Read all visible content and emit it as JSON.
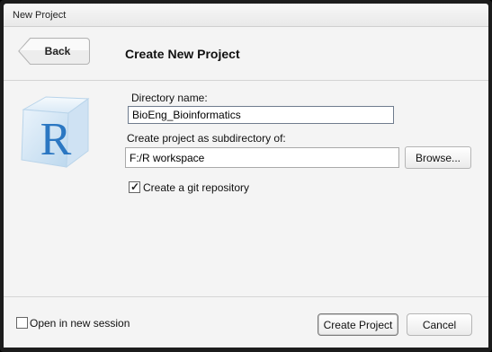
{
  "window": {
    "title": "New Project"
  },
  "header": {
    "back_label": "Back",
    "page_title": "Create New Project"
  },
  "form": {
    "directory_label": "Directory name:",
    "directory_value": "BioEng_Bioinformatics",
    "subdir_label": "Create project as subdirectory of:",
    "subdir_value": "F:/R workspace",
    "browse_label": "Browse...",
    "git_label": "Create a git repository",
    "git_checked": true
  },
  "logo": {
    "letter": "R",
    "icon": "r-cube-icon",
    "color": "#2b77c2"
  },
  "footer": {
    "session_label": "Open in new session",
    "session_checked": false,
    "create_label": "Create Project",
    "cancel_label": "Cancel"
  }
}
